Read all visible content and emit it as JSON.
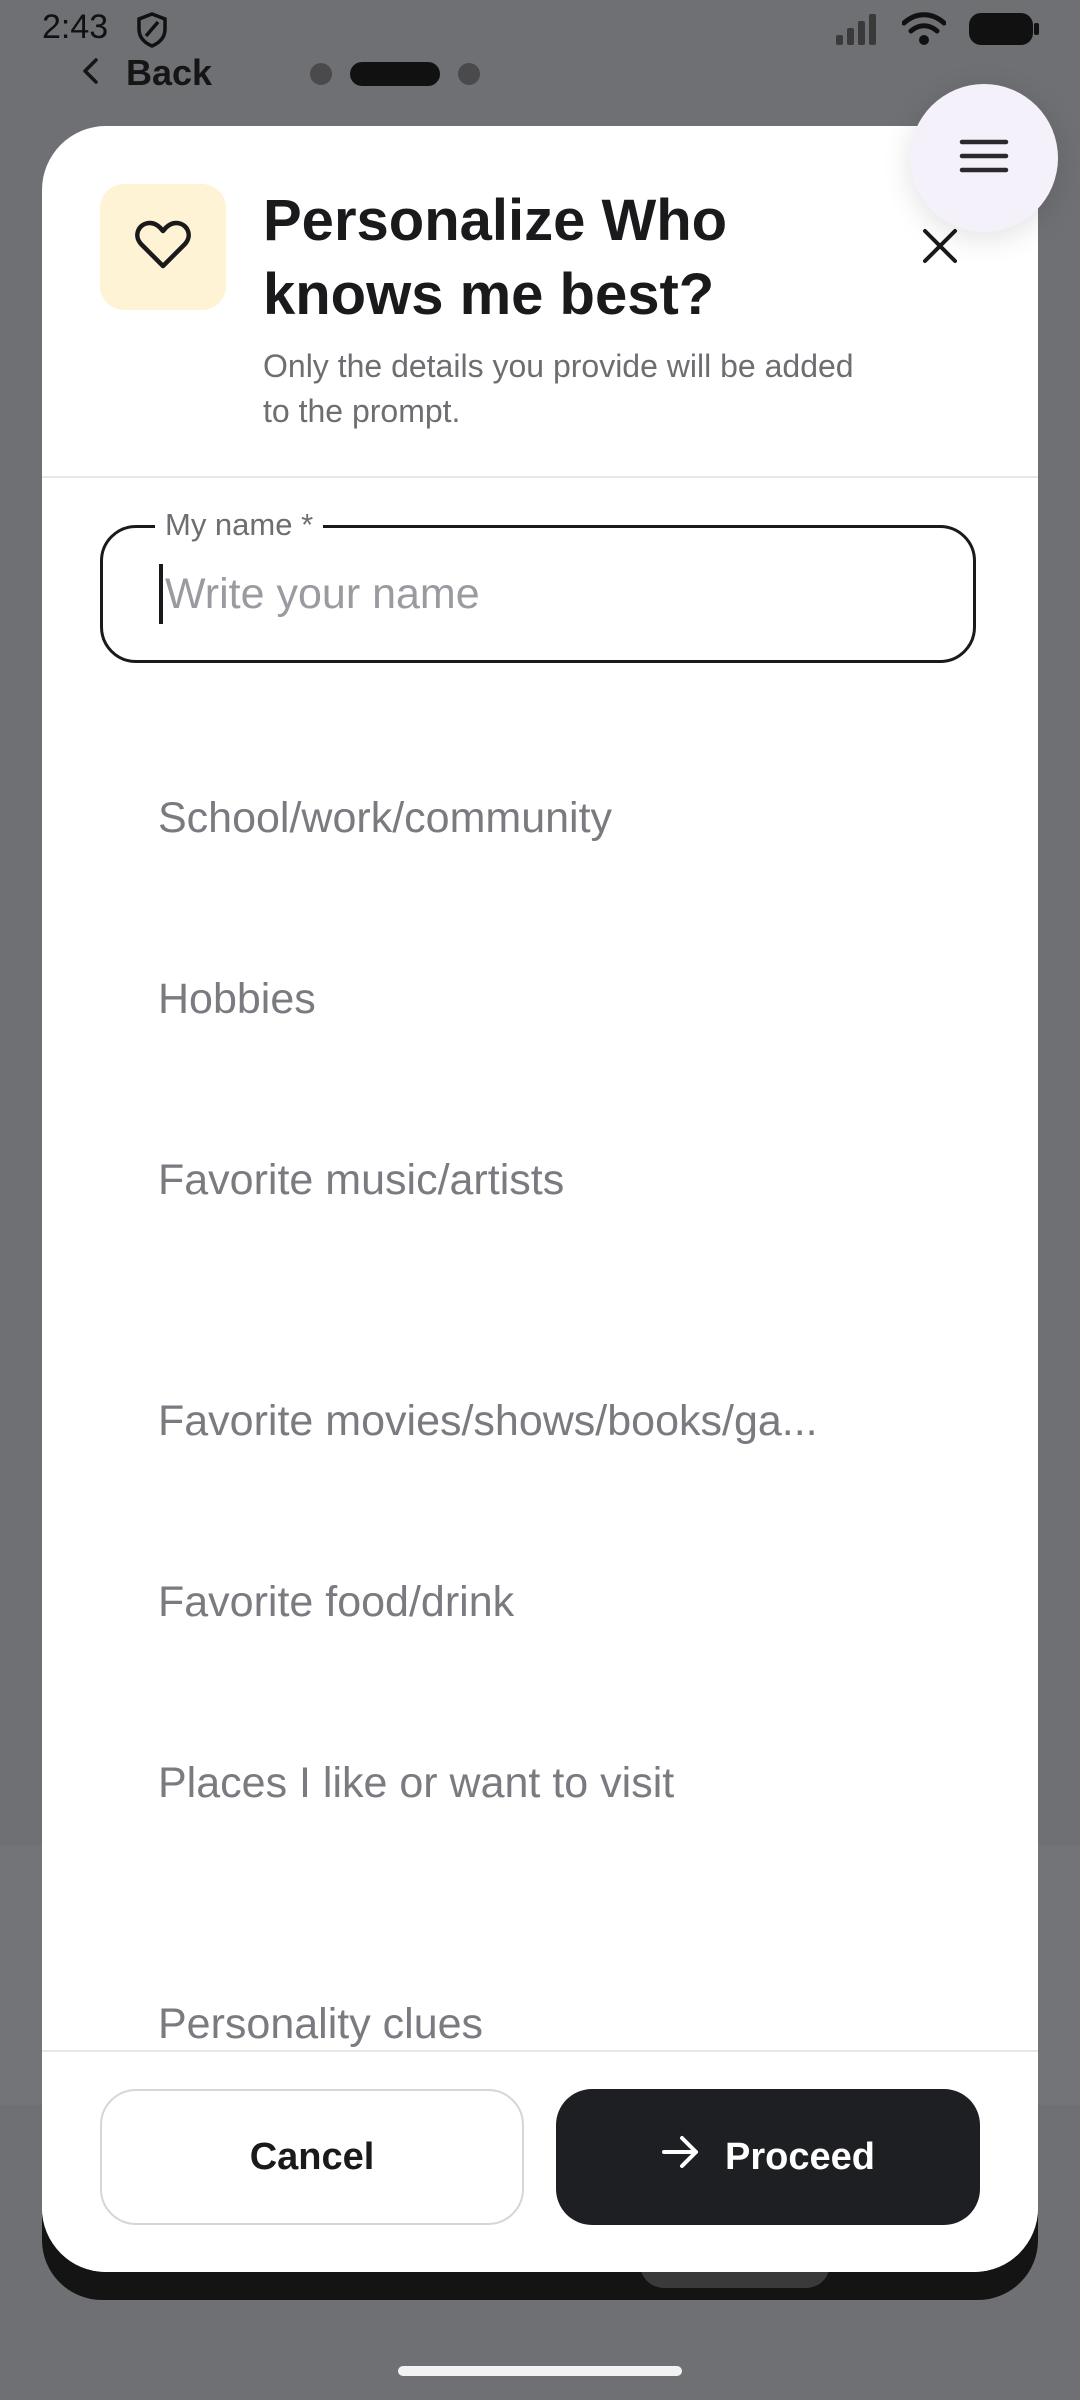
{
  "status_bar": {
    "time": "2:43"
  },
  "nav": {
    "back_label": "Back"
  },
  "modal": {
    "title": "Personalize Who knows me best?",
    "subtitle": "Only the details you provide will be added to the prompt.",
    "name_field": {
      "label": "My name *",
      "placeholder": "Write your name",
      "value": ""
    },
    "fields": [
      {
        "key": "school",
        "placeholder": "School/work/community"
      },
      {
        "key": "hobbies",
        "placeholder": "Hobbies"
      },
      {
        "key": "music",
        "placeholder": "Favorite music/artists"
      },
      {
        "key": "media",
        "placeholder": "Favorite movies/shows/books/ga..."
      },
      {
        "key": "food",
        "placeholder": "Favorite food/drink"
      },
      {
        "key": "places",
        "placeholder": "Places I like or want to visit"
      },
      {
        "key": "personality",
        "placeholder": "Personality clues"
      }
    ],
    "footer": {
      "cancel_label": "Cancel",
      "proceed_label": "Proceed"
    }
  },
  "colors": {
    "backdrop": "#6f7073",
    "accent_dark": "#1e1f22",
    "icon_bg": "#fff3d6",
    "placeholder": "#7a7a80"
  },
  "icons": [
    "shield-icon",
    "signal-icon",
    "wifi-icon",
    "battery-icon",
    "chevron-left-icon",
    "heart-icon",
    "close-icon",
    "menu-icon",
    "arrow-right-icon"
  ]
}
